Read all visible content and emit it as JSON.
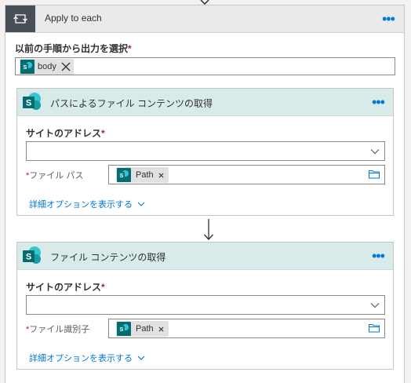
{
  "apply": {
    "title": "Apply to each",
    "select_label": "以前の手順から出力を選択",
    "required_mark": "*",
    "token": "body"
  },
  "cards": [
    {
      "title": "パスによるファイル コンテンツの取得",
      "site_label": "サイトのアドレス",
      "site_value": "",
      "file_label": "ファイル パス",
      "file_token": "Path",
      "advanced_link": "詳細オプションを表示する"
    },
    {
      "title": "ファイル コンテンツの取得",
      "site_label": "サイトのアドレス",
      "site_value": "",
      "file_label": "ファイル識別子",
      "file_token": "Path",
      "advanced_link": "詳細オプションを表示する"
    }
  ],
  "icons": {
    "loop": "loop-icon",
    "more": "ellipsis-icon",
    "sharepoint": "sharepoint-icon",
    "remove": "close-icon",
    "dropdown": "chevron-down-icon",
    "folder": "folder-icon",
    "arrow": "arrow-down-icon"
  },
  "colors": {
    "accent": "#0078d4",
    "sharepoint": "#036c70",
    "card_header": "#d9eaeb",
    "loop_header": "#484f58",
    "required": "#a4262c"
  }
}
